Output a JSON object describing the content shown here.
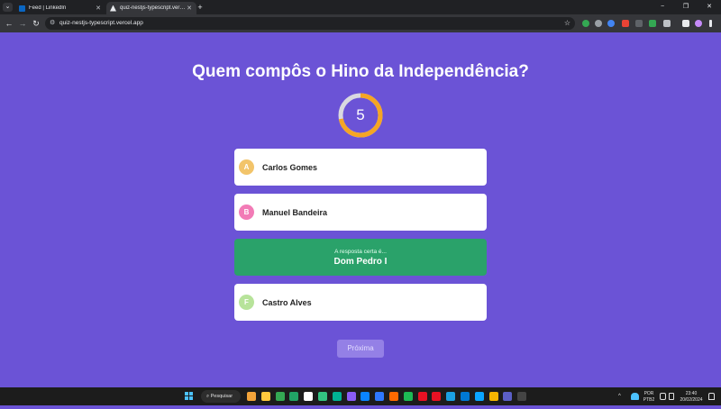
{
  "browser": {
    "tab_menu_icon": "chevron-down-icon",
    "tabs": [
      {
        "title": "Feed | LinkedIn",
        "favicon_color": "#0a66c2",
        "active": false
      },
      {
        "title": "quiz-nestjs-typescript.vercel.app",
        "favicon_color": "#e8eaed",
        "active": true
      }
    ],
    "new_tab_label": "+",
    "window_controls": {
      "minimize": "−",
      "restore": "❐",
      "close": "✕"
    },
    "nav": {
      "back": "←",
      "forward": "→",
      "reload": "↻"
    },
    "address": "quiz-nestjs-typescript.vercel.app",
    "site_info_icon": "tune-icon",
    "bookmark_icon": "star-icon",
    "extensions": [
      "#34a853",
      "#9aa0a6",
      "#4285f4",
      "#ea4335",
      "#5f6368",
      "#34a853",
      "#bdc1c6",
      "#e8eaed",
      "#c58af9"
    ]
  },
  "quiz": {
    "question": "Quem compôs o Hino da Independência?",
    "timer": {
      "value": "5",
      "remaining_fraction": 0.72,
      "ring_color": "#f5a524",
      "track_color": "#d9d9e0"
    },
    "answers": [
      {
        "letter": "A",
        "text": "Carlos Gomes",
        "letter_color": "#f2c46a"
      },
      {
        "letter": "B",
        "text": "Manuel Bandeira",
        "letter_color": "#f27bb6"
      },
      {
        "reveal_caption": "A resposta certa é...",
        "text": "Dom Pedro I",
        "correct": true
      },
      {
        "letter": "F",
        "text": "Castro Alves",
        "letter_color": "#b7e39a"
      }
    ],
    "next_label": "Próxima"
  },
  "taskbar": {
    "search_label": "Pesquisar",
    "apps": [
      "#f2a33a",
      "#ffc83d",
      "#34a853",
      "#21a366",
      "#ffffff",
      "#33c481",
      "#00b294",
      "#8a5cf6",
      "#0a84ff",
      "#2f78ff",
      "#ff6a00",
      "#1db954",
      "#e81123",
      "#e81123",
      "#1ba1e2",
      "#0078d4",
      "#0aa5ff",
      "#f4b400",
      "#5b5fc7",
      "#444444"
    ],
    "tray": {
      "chevron": "^",
      "lang": "POR",
      "layout": "PTB2",
      "time": "23:40",
      "date": "20/02/2024"
    }
  }
}
